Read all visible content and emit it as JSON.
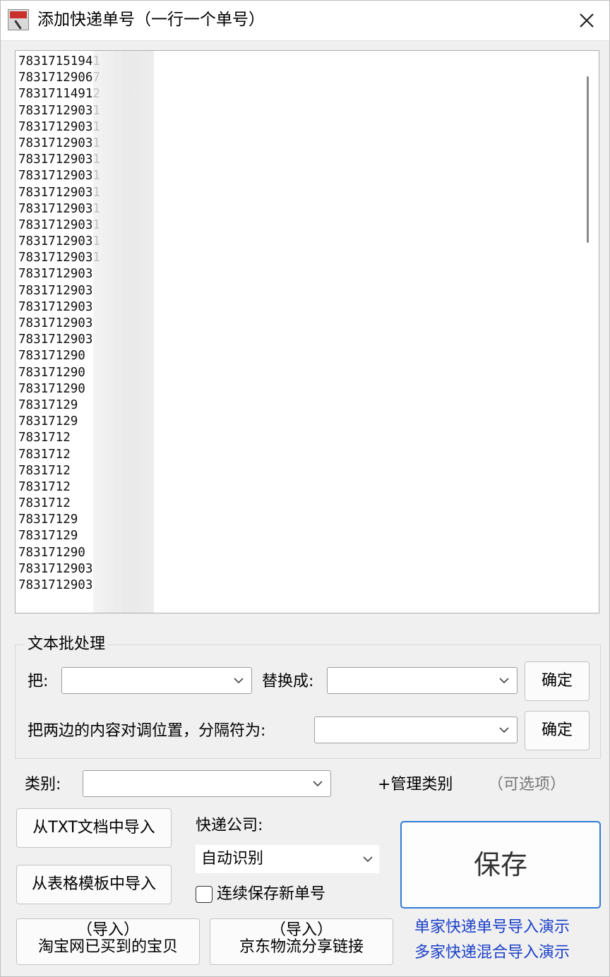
{
  "window": {
    "title": "添加快递单号（一行一个单号）",
    "close_icon": "close-icon"
  },
  "editor": {
    "lines": [
      "78317151941",
      "78317129067",
      "78317114912",
      "78317129031",
      "78317129031",
      "78317129031",
      "78317129031",
      "78317129031",
      "78317129031",
      "78317129031",
      "78317129031",
      "78317129031",
      "78317129031",
      "7831712903",
      "7831712903",
      "7831712903",
      "7831712903",
      "7831712903",
      "783171290",
      "783171290",
      "783171290",
      "78317129",
      "78317129",
      "7831712",
      "7831712",
      "7831712",
      "7831712",
      "7831712",
      "78317129",
      "78317129",
      "783171290",
      "7831712903",
      "7831712903"
    ]
  },
  "batch": {
    "title": "文本批处理",
    "replace_from_label": "把:",
    "replace_from_value": "",
    "replace_to_label": "替换成:",
    "replace_to_value": "",
    "confirm_label": "确定",
    "swap_label": "把两边的内容对调位置，分隔符为:",
    "swap_value": "",
    "swap_confirm_label": "确定"
  },
  "category": {
    "label": "类别:",
    "value": "",
    "manage_label": "+管理类别",
    "optional_label": "（可选项）"
  },
  "import": {
    "txt_label": "从TXT文档中导入",
    "excel_label": "从表格模板中导入",
    "taobao_line1": "（导入）",
    "taobao_line2": "淘宝网已买到的宝贝",
    "jd_line1": "（导入）",
    "jd_line2": "京东物流分享链接"
  },
  "courier": {
    "label": "快递公司:",
    "value": "自动识别",
    "continuous_label": "连续保存新单号",
    "continuous_checked": false
  },
  "save": {
    "label": "保存"
  },
  "demos": {
    "single": "单家快递单号导入演示",
    "mixed": "多家快递混合导入演示"
  },
  "colors": {
    "accent": "#2f7bd8",
    "link": "#1a3fc9"
  }
}
